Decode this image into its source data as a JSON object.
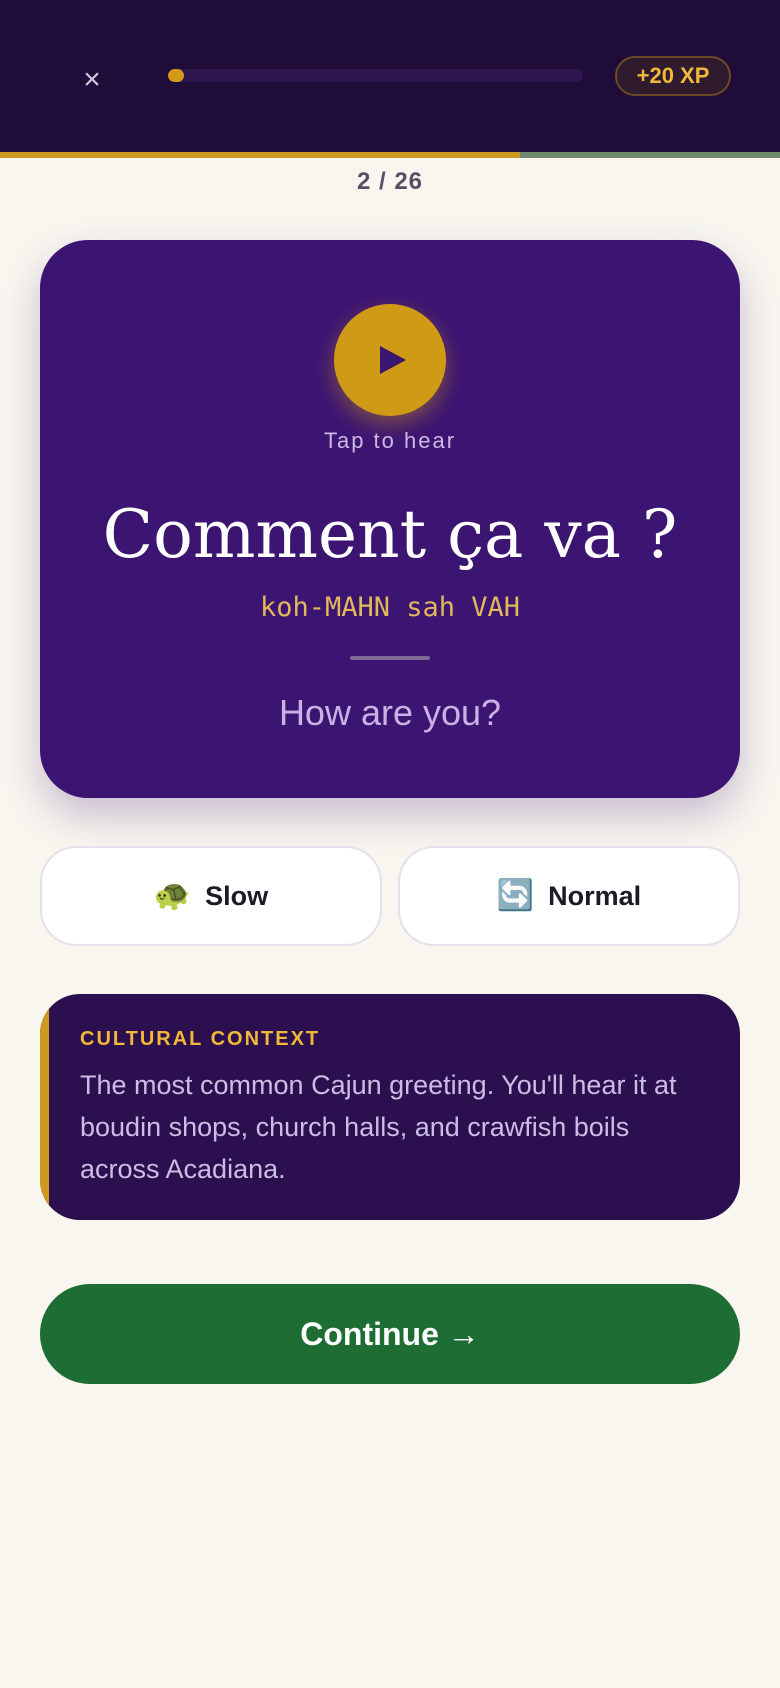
{
  "header": {
    "close_label": "×",
    "progress_fraction": 0.0385,
    "xp_label": "+20 XP"
  },
  "counter": "2 / 26",
  "card": {
    "tap_label": "Tap to hear",
    "phrase": "Comment ça va ?",
    "pronunciation": "koh-MAHN sah VAH",
    "translation": "How are you?"
  },
  "speed": {
    "slow": {
      "icon": "🐢",
      "label": "Slow"
    },
    "normal": {
      "icon": "🔄",
      "label": "Normal"
    }
  },
  "context": {
    "title": "CULTURAL CONTEXT",
    "body": "The most common Cajun greeting. You'll hear it at boudin shops, church halls, and crawfish boils across Acadiana."
  },
  "continue_label": "Continue →",
  "colors": {
    "header_bg": "#1f0c38",
    "accent_gold": "#cc9a1e",
    "card_purple": "#3c1472",
    "context_bg": "#2b0f4f",
    "continue_green": "#1e6d34"
  },
  "icons": {
    "close": "close-icon",
    "play": "play-icon",
    "slow": "turtle-icon",
    "normal": "repeat-icon"
  }
}
